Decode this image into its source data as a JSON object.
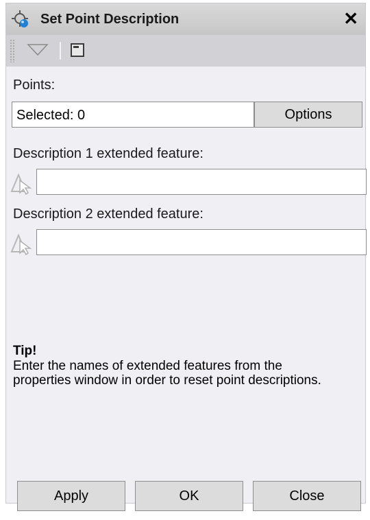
{
  "window": {
    "title": "Set Point Description",
    "close_glyph": "✕"
  },
  "toolbar": {
    "icons": [
      "dropdown-triangle-icon",
      "window-icon"
    ]
  },
  "points": {
    "label": "Points:",
    "selected_value": "Selected: 0",
    "options_label": "Options"
  },
  "description1": {
    "label": "Description 1 extended feature:",
    "value": "",
    "icon": "pick-feature-icon"
  },
  "description2": {
    "label": "Description 2 extended feature:",
    "value": "",
    "icon": "pick-feature-icon"
  },
  "tip": {
    "title": "Tip!",
    "text": "Enter the names of extended features from the properties window in order to reset point descriptions."
  },
  "buttons": {
    "apply": "Apply",
    "ok": "OK",
    "close": "Close"
  },
  "colors": {
    "panel_bg": "#efeff4",
    "titlebar_bg": "#c6c6c6",
    "toolbar_bg": "#d2d2d6",
    "button_bg": "#dcdcdc"
  }
}
